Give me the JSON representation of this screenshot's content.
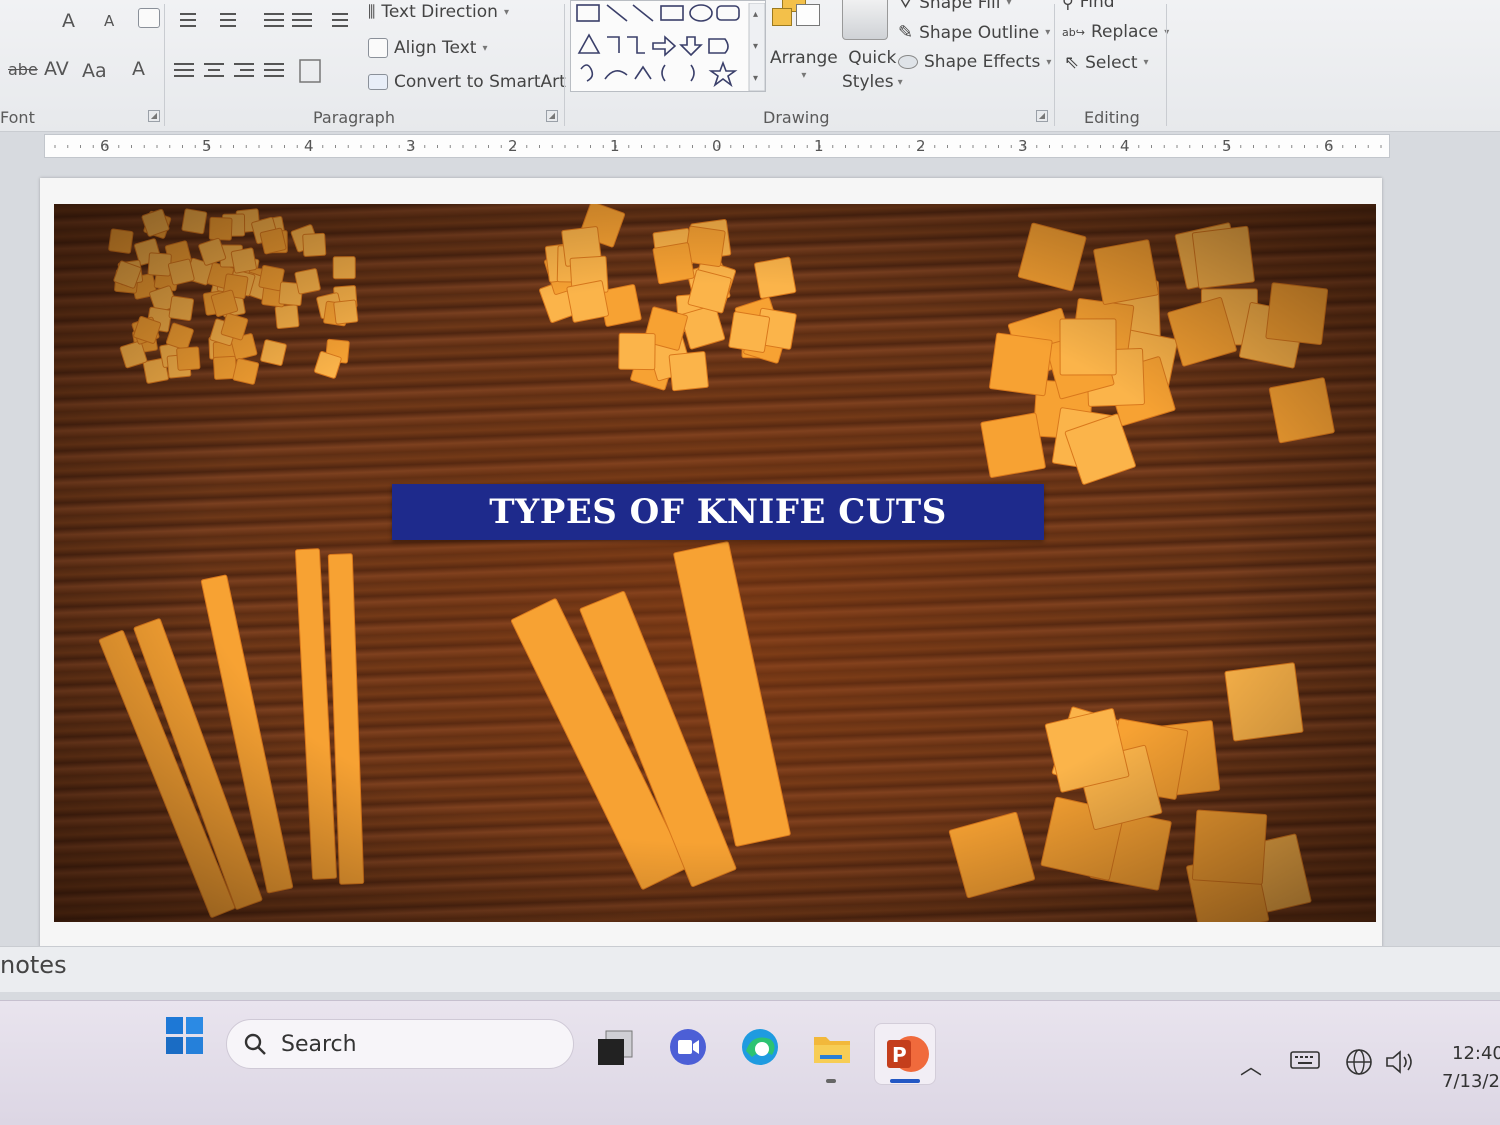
{
  "ribbon": {
    "groups": {
      "font": "Font",
      "paragraph": "Paragraph",
      "drawing": "Drawing",
      "editing": "Editing"
    },
    "paragraph": {
      "text_direction": "Text Direction",
      "align_text": "Align Text",
      "convert_smartart": "Convert to SmartArt"
    },
    "drawing": {
      "arrange": "Arrange",
      "quick_styles_line1": "Quick",
      "quick_styles_line2": "Styles",
      "shape_fill": "Shape Fill",
      "shape_outline": "Shape Outline",
      "shape_effects": "Shape Effects"
    },
    "editing": {
      "find": "Find",
      "replace": "Replace",
      "select": "Select"
    },
    "font_glyphs": {
      "grow": "A",
      "shrink": "A",
      "strike": "abe",
      "spacing": "AV",
      "case": "Aa",
      "color": "A"
    }
  },
  "ruler": {
    "labels": [
      "6",
      "5",
      "4",
      "3",
      "2",
      "1",
      "0",
      "1",
      "2",
      "3",
      "4",
      "5",
      "6"
    ]
  },
  "slide": {
    "title": "TYPES OF KNIFE CUTS"
  },
  "notes": {
    "label": "notes"
  },
  "taskbar": {
    "search_placeholder": "Search",
    "clock_time": "12:40",
    "clock_date": "7/13/2"
  },
  "colors": {
    "title_bar": "#1e2a8c",
    "squash": "#f7a233",
    "wood": "#5a2d14"
  }
}
